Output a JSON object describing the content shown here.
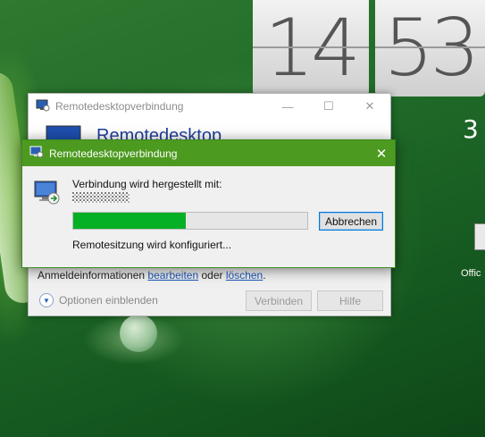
{
  "clock": {
    "hours": "14",
    "minutes": "53"
  },
  "weather": {
    "temp_partial": "3"
  },
  "desktop_side_label": "Offic",
  "back_window": {
    "title": "Remotedesktopverbindung",
    "header_text": "Remotedesktop",
    "credentials_text": "Anmeldeinformationen",
    "edit_link": "bearbeiten",
    "or_text": "oder",
    "delete_link": "löschen",
    "period": ".",
    "show_options": "Optionen einblenden",
    "connect_button": "Verbinden",
    "help_button": "Hilfe",
    "minimize": "—",
    "maximize": "☐",
    "close": "✕"
  },
  "front_window": {
    "title": "Remotedesktopverbindung",
    "close": "✕",
    "connecting_label": "Verbindung wird hergestellt mit:",
    "progress_fraction": 0.48,
    "progress_color": "#06b025",
    "cancel_button": "Abbrechen",
    "status_text": "Remotesitzung wird konfiguriert..."
  },
  "colors": {
    "title_bar_active": "#4c9a1f",
    "header_blue": "#1f3f99",
    "link": "#1d58b8"
  }
}
